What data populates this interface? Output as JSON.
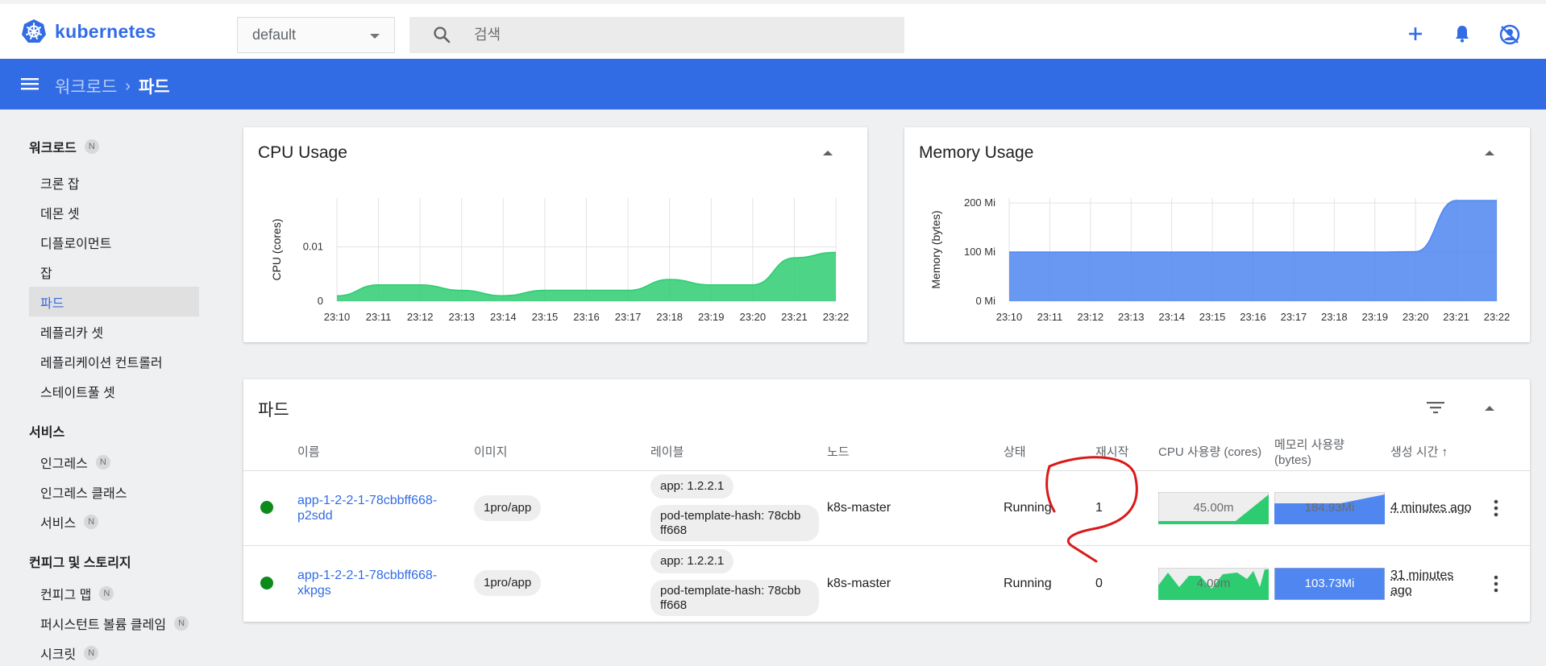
{
  "app": {
    "logo_text": "kubernetes",
    "brand_color": "#326ce5",
    "namespace": "default",
    "search_placeholder": "검색"
  },
  "breadcrumb": {
    "parent": "워크로드",
    "separator": "›",
    "current": "파드"
  },
  "sidebar": {
    "sections": [
      {
        "label": "워크로드",
        "badge": "N"
      },
      {
        "label": "서비스",
        "badge": ""
      },
      {
        "label": "컨피그 및 스토리지",
        "badge": ""
      }
    ],
    "workload_items": [
      {
        "label": "크론 잡",
        "badge": ""
      },
      {
        "label": "데몬 셋",
        "badge": ""
      },
      {
        "label": "디플로이먼트",
        "badge": ""
      },
      {
        "label": "잡",
        "badge": ""
      },
      {
        "label": "파드",
        "badge": ""
      },
      {
        "label": "레플리카 셋",
        "badge": ""
      },
      {
        "label": "레플리케이션 컨트롤러",
        "badge": ""
      },
      {
        "label": "스테이트풀 셋",
        "badge": ""
      }
    ],
    "service_items": [
      {
        "label": "인그레스",
        "badge": "N"
      },
      {
        "label": "인그레스 클래스",
        "badge": ""
      },
      {
        "label": "서비스",
        "badge": "N"
      }
    ],
    "config_items": [
      {
        "label": "컨피그 맵",
        "badge": "N"
      },
      {
        "label": "퍼시스턴트 볼륨 클레임",
        "badge": "N"
      },
      {
        "label": "시크릿",
        "badge": "N"
      }
    ]
  },
  "cpu_card": {
    "title": "CPU Usage"
  },
  "memory_card": {
    "title": "Memory Usage"
  },
  "chart_data": [
    {
      "type": "area",
      "title": "CPU Usage",
      "xlabel": "",
      "ylabel": "CPU (cores)",
      "x": [
        "23:10",
        "23:11",
        "23:12",
        "23:13",
        "23:14",
        "23:15",
        "23:16",
        "23:17",
        "23:18",
        "23:19",
        "23:20",
        "23:21",
        "23:22"
      ],
      "y_ticks": [
        "0",
        "0.01"
      ],
      "ylim": [
        0,
        0.019
      ],
      "grid": true,
      "color": "#2ecc71",
      "series": [
        {
          "values": [
            0.001,
            0.003,
            0.003,
            0.002,
            0.001,
            0.002,
            0.002,
            0.002,
            0.004,
            0.003,
            0.003,
            0.008,
            0.009
          ]
        }
      ]
    },
    {
      "type": "area",
      "title": "Memory Usage",
      "xlabel": "",
      "ylabel": "Memory (bytes)",
      "x": [
        "23:10",
        "23:11",
        "23:12",
        "23:13",
        "23:14",
        "23:15",
        "23:16",
        "23:17",
        "23:18",
        "23:19",
        "23:20",
        "23:21",
        "23:22"
      ],
      "y_ticks": [
        "0 Mi",
        "100 Mi",
        "200 Mi"
      ],
      "ylim": [
        0,
        210
      ],
      "grid": true,
      "color": "#4f86f0",
      "series": [
        {
          "values": [
            100,
            100,
            100,
            100,
            100,
            100,
            100,
            100,
            100,
            100,
            101,
            205,
            205
          ]
        }
      ]
    }
  ],
  "pods_card": {
    "title": "파드",
    "columns": [
      "이름",
      "이미지",
      "레이블",
      "노드",
      "상태",
      "재시작",
      "CPU 사용량 (cores)",
      "메모리 사용량 (bytes)",
      "생성 시간"
    ],
    "sort_arrow": "↑",
    "rows": [
      {
        "name_line1": "app-1-2-2-1-78cbbff668-",
        "name_line2": "p2sdd",
        "image": "1pro/app",
        "label1": "app: 1.2.2.1",
        "label2_line1": "pod-template-hash: 78cbb",
        "label2_line2": "ff668",
        "node": "k8s-master",
        "status": "Running",
        "restarts": "1",
        "cpu": "45.00m",
        "cpu_fraction": 0.35,
        "memory": "184.93Mi",
        "age_line1": "4 minutes ago",
        "age_line2": ""
      },
      {
        "name_line1": "app-1-2-2-1-78cbbff668-",
        "name_line2": "xkpgs",
        "image": "1pro/app",
        "label1": "app: 1.2.2.1",
        "label2_line1": "pod-template-hash: 78cbb",
        "label2_line2": "ff668",
        "node": "k8s-master",
        "status": "Running",
        "restarts": "0",
        "cpu": "4.00m",
        "cpu_fraction": 0.8,
        "memory": "103.73Mi",
        "age_line1": "31 minutes",
        "age_line2": "ago"
      }
    ]
  }
}
